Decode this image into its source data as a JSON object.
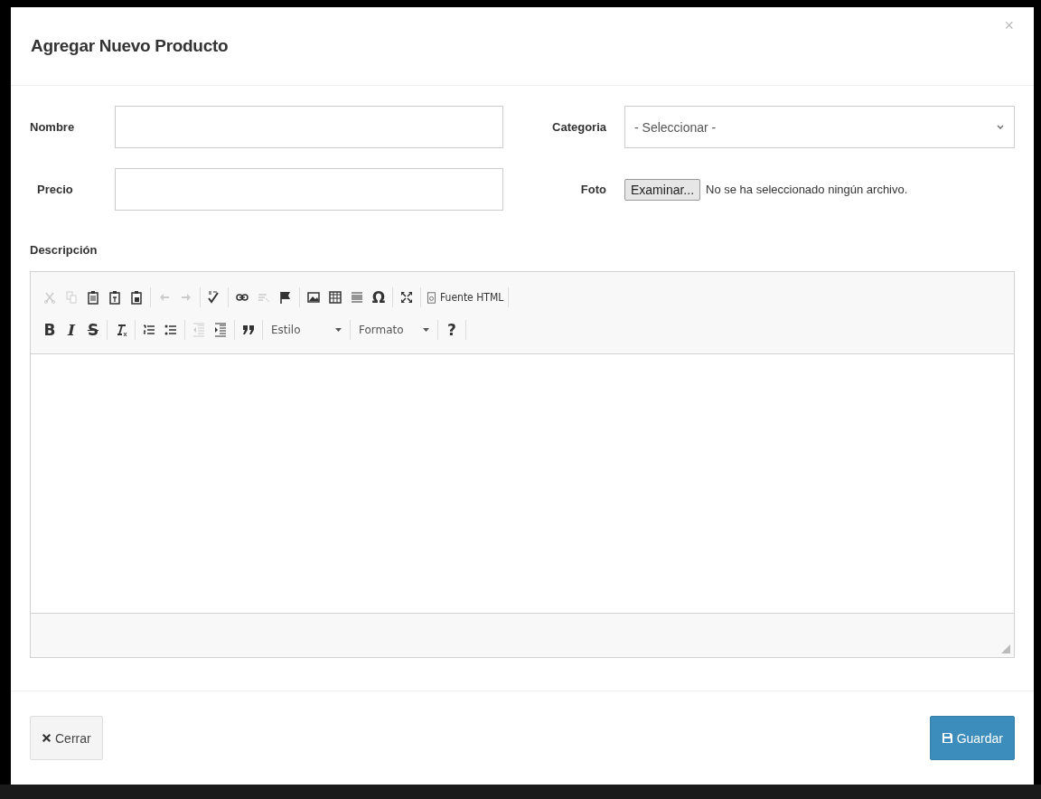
{
  "dialog": {
    "title": "Agregar Nuevo Producto",
    "close": "×"
  },
  "fields": [
    {
      "kind": "text",
      "label": "Nombre"
    },
    {
      "kind": "select",
      "label": "Categoria",
      "value": "- Seleccionar -"
    },
    {
      "kind": "text",
      "label": "Precio"
    },
    {
      "kind": "file",
      "label": "Foto",
      "button": "Examinar...",
      "status": "No se ha seleccionado ningún archivo."
    }
  ],
  "editor": {
    "label": "Descripción",
    "toolbar_rows": [
      [
        [
          {
            "kind": "icon",
            "disabled": true
          },
          {
            "kind": "icon",
            "disabled": true
          },
          {
            "kind": "icon",
            "disabled": false
          },
          {
            "kind": "icon",
            "disabled": false
          },
          {
            "kind": "icon",
            "disabled": false
          }
        ],
        [
          {
            "kind": "icon",
            "disabled": true
          },
          {
            "kind": "icon",
            "disabled": true
          }
        ],
        [
          {
            "kind": "icon",
            "disabled": false
          }
        ],
        [
          {
            "kind": "icon",
            "disabled": false
          },
          {
            "kind": "icon",
            "disabled": true
          },
          {
            "kind": "icon",
            "disabled": false
          }
        ],
        [
          {
            "kind": "icon",
            "disabled": false
          },
          {
            "kind": "icon",
            "disabled": false
          },
          {
            "kind": "icon",
            "disabled": false
          },
          {
            "kind": "glyph",
            "label": "Ω"
          }
        ],
        [
          {
            "kind": "icon",
            "disabled": false
          }
        ],
        [
          {
            "kind": "labeled",
            "label": "Fuente HTML"
          }
        ]
      ],
      [
        [
          {
            "kind": "glyph",
            "label": "B"
          },
          {
            "kind": "glyph",
            "label": "I"
          },
          {
            "kind": "glyph",
            "label": "S"
          }
        ],
        [
          {
            "kind": "icon",
            "disabled": false
          }
        ],
        [
          {
            "kind": "icon",
            "disabled": false
          },
          {
            "kind": "icon",
            "disabled": false
          }
        ],
        [
          {
            "kind": "icon",
            "disabled": true
          },
          {
            "kind": "icon",
            "disabled": false
          }
        ],
        [
          {
            "kind": "icon",
            "disabled": false
          }
        ],
        [
          {
            "kind": "combo",
            "label": "Estilo"
          }
        ],
        [
          {
            "kind": "combo",
            "label": "Formato"
          }
        ],
        [
          {
            "kind": "glyph",
            "label": "?"
          }
        ]
      ]
    ]
  },
  "footer": {
    "buttons": [
      {
        "kind": "default",
        "label": "Cerrar"
      },
      {
        "kind": "primary",
        "label": "Guardar"
      }
    ]
  }
}
